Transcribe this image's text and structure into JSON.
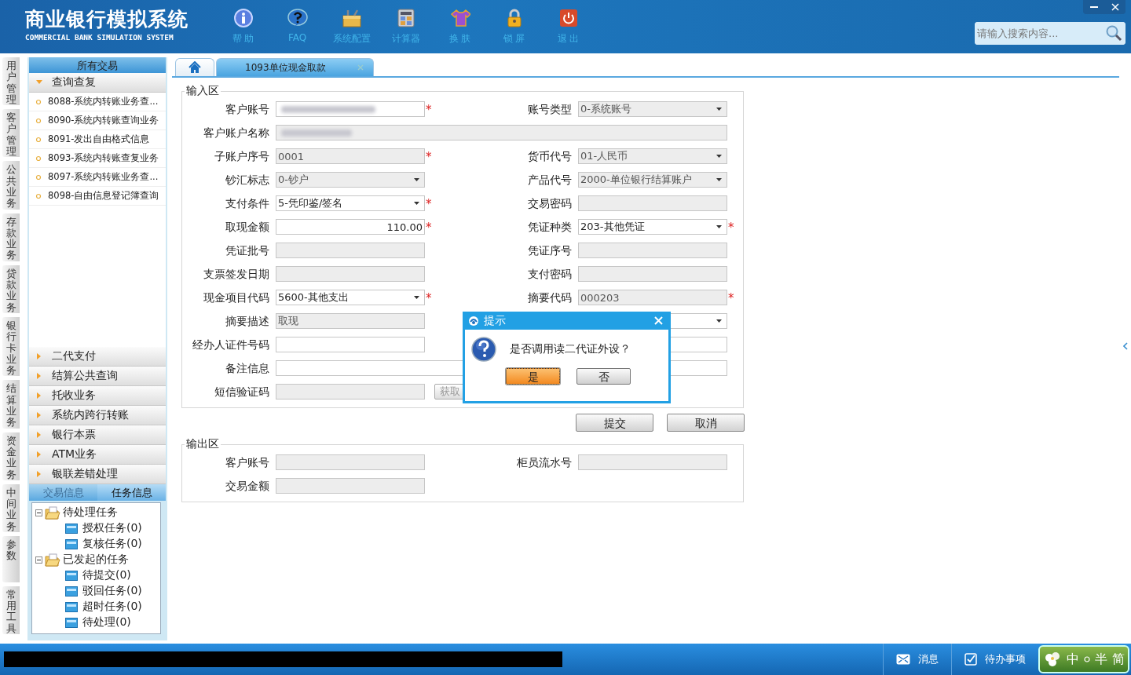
{
  "header": {
    "title": "商业银行模拟系统",
    "subtitle": "COMMERCIAL BANK SIMULATION SYSTEM",
    "tools": [
      {
        "kind": "info",
        "label": "帮 助"
      },
      {
        "kind": "faq",
        "label": "FAQ"
      },
      {
        "kind": "config",
        "label": "系统配置"
      },
      {
        "kind": "calc",
        "label": "计算器"
      },
      {
        "kind": "skin",
        "label": "换 肤"
      },
      {
        "kind": "lock",
        "label": "锁 屏"
      },
      {
        "kind": "exit",
        "label": "退 出"
      }
    ],
    "search": {
      "placeholder": "请输入搜索内容..."
    }
  },
  "side_tabs": [
    "用户管理",
    "客户管理",
    "公共业务",
    "存款业务",
    "贷款业务",
    "银行卡业务",
    "结算业务",
    "资金业务",
    "中间业务",
    "参数",
    "常用工具"
  ],
  "nav": {
    "title": "所有交易",
    "groups": [
      {
        "label": "查询查复",
        "expanded": true,
        "items": [
          "8088-系统内转账业务查...",
          "8090-系统内转账查询业务",
          "8091-发出自由格式信息",
          "8093-系统内转账查复业务",
          "8097-系统内转账业务查...",
          "8098-自由信息登记簿查询"
        ]
      },
      {
        "label": "二代支付",
        "expanded": false
      },
      {
        "label": "结算公共查询",
        "expanded": false
      },
      {
        "label": "托收业务",
        "expanded": false
      },
      {
        "label": "系统内跨行转账",
        "expanded": false
      },
      {
        "label": "银行本票",
        "expanded": false
      },
      {
        "label": "ATM业务",
        "expanded": false
      },
      {
        "label": "银联差错处理",
        "expanded": false
      }
    ],
    "info_tabs": [
      {
        "label": "交易信息",
        "selected": false
      },
      {
        "label": "任务信息",
        "selected": true
      }
    ],
    "tree": [
      {
        "label": "待处理任务",
        "expanded": true,
        "children": [
          {
            "label": "授权任务(0)"
          },
          {
            "label": "复核任务(0)"
          }
        ]
      },
      {
        "label": "已发起的任务",
        "expanded": true,
        "children": [
          {
            "label": "待提交(0)"
          },
          {
            "label": "驳回任务(0)"
          },
          {
            "label": "超时任务(0)"
          },
          {
            "label": "待处理(0)"
          }
        ]
      }
    ]
  },
  "tabs": [
    {
      "kind": "home",
      "selected": false
    },
    {
      "kind": "page",
      "label": "1093单位现金取款",
      "selected": true,
      "closable": true
    }
  ],
  "input_area": {
    "title": "输入区",
    "rows": [
      {
        "fields": [
          {
            "label": "客户账号",
            "kind": "input",
            "blurred": true,
            "flag": "*",
            "disabled": false
          },
          {
            "label": "账号类型",
            "kind": "select",
            "value": "0-系统账号",
            "disabled": true
          }
        ]
      },
      {
        "fields": [
          {
            "label": "客户账户名称",
            "kind": "wide",
            "blurred": true,
            "disabled": true
          }
        ]
      },
      {
        "fields": [
          {
            "label": "子账户序号",
            "kind": "input",
            "value": "0001",
            "flag": "*",
            "disabled": true
          },
          {
            "label": "货币代号",
            "kind": "select",
            "value": "01-人民币",
            "disabled": true
          }
        ]
      },
      {
        "fields": [
          {
            "label": "钞汇标志",
            "kind": "select",
            "value": "0-钞户",
            "disabled": true
          },
          {
            "label": "产品代号",
            "kind": "select",
            "value": "2000-单位银行结算账户",
            "disabled": true
          }
        ]
      },
      {
        "fields": [
          {
            "label": "支付条件",
            "kind": "select",
            "value": "5-凭印鉴/签名",
            "flag": "*",
            "disabled": false
          },
          {
            "label": "交易密码",
            "kind": "input",
            "disabled": true
          }
        ]
      },
      {
        "fields": [
          {
            "label": "取现金额",
            "kind": "amount",
            "value": "110.00",
            "flag": "*",
            "disabled": false
          },
          {
            "label": "凭证种类",
            "kind": "select",
            "value": "203-其他凭证",
            "flag": "*",
            "disabled": false
          }
        ]
      },
      {
        "fields": [
          {
            "label": "凭证批号",
            "kind": "input",
            "disabled": true
          },
          {
            "label": "凭证序号",
            "kind": "input",
            "disabled": true
          }
        ]
      },
      {
        "fields": [
          {
            "label": "支票签发日期",
            "kind": "input",
            "disabled": true
          },
          {
            "label": "支付密码",
            "kind": "input",
            "disabled": true
          }
        ]
      },
      {
        "fields": [
          {
            "label": "现金项目代码",
            "kind": "select",
            "value": "5600-其他支出",
            "flag": "*",
            "disabled": false
          },
          {
            "label": "摘要代码",
            "kind": "input",
            "value": "000203",
            "flag": "*",
            "disabled": true
          }
        ]
      },
      {
        "fields": [
          {
            "label": "摘要描述",
            "kind": "input",
            "value": "取现",
            "disabled": true
          },
          {
            "kind": "select",
            "disabled": false
          }
        ]
      },
      {
        "fields": [
          {
            "label": "经办人证件号码",
            "kind": "input",
            "disabled": false
          },
          {
            "kind": "input",
            "disabled": false
          }
        ]
      },
      {
        "fields": [
          {
            "label": "备注信息",
            "kind": "wide",
            "disabled": false
          }
        ]
      },
      {
        "fields": [
          {
            "label": "短信验证码",
            "kind": "input",
            "disabled": true
          },
          {
            "kind": "button",
            "label": "获取"
          }
        ]
      }
    ]
  },
  "actions": [
    "提交",
    "取消"
  ],
  "output_area": {
    "title": "输出区",
    "rows": [
      {
        "fields": [
          {
            "label": "客户账号",
            "disabled": true
          },
          {
            "label": "柜员流水号",
            "disabled": true
          }
        ]
      },
      {
        "fields": [
          {
            "label": "交易金额",
            "disabled": true
          }
        ]
      }
    ]
  },
  "dialog": {
    "title": "提示",
    "message": "是否调用读二代证外设？",
    "buttons": [
      {
        "label": "是",
        "selected": true
      },
      {
        "label": "否",
        "selected": false
      }
    ]
  },
  "status_bar": {
    "redacted": true,
    "items": [
      {
        "kind": "message",
        "label": "消息"
      },
      {
        "kind": "todo",
        "label": "待办事项"
      }
    ],
    "ime": [
      "中",
      "半",
      "简"
    ]
  }
}
